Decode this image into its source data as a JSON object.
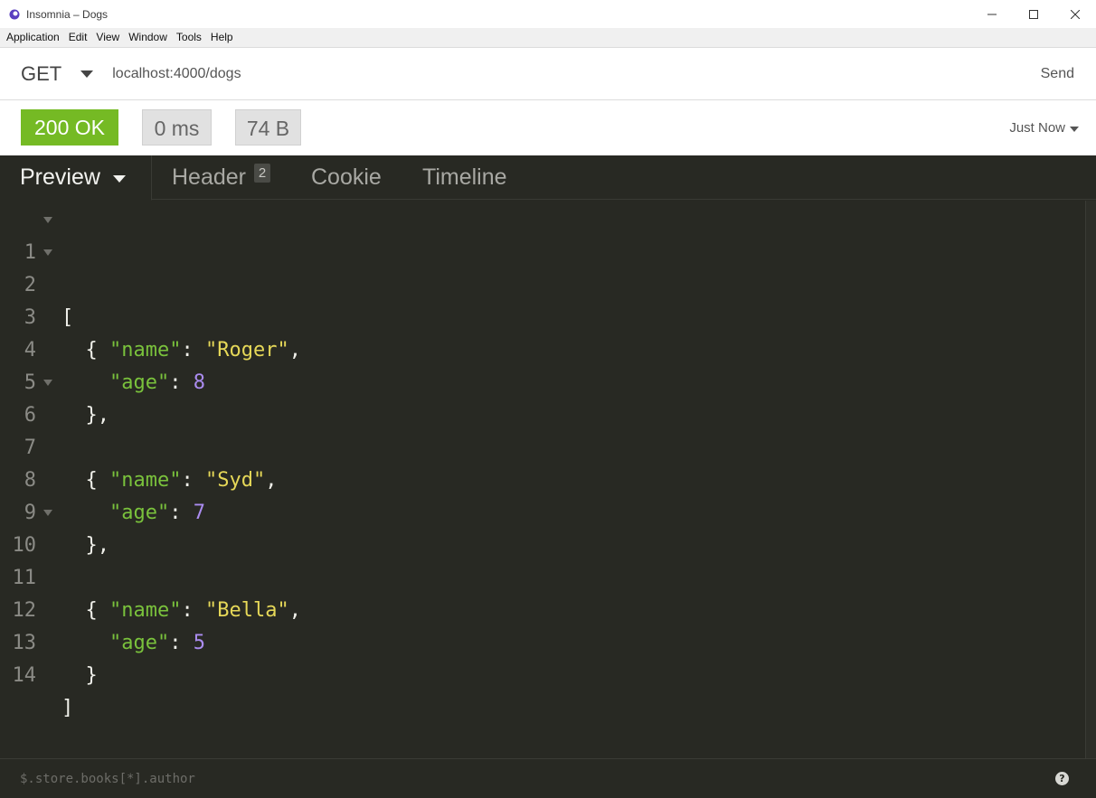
{
  "window": {
    "title": "Insomnia – Dogs"
  },
  "menu": {
    "items": [
      "Application",
      "Edit",
      "View",
      "Window",
      "Tools",
      "Help"
    ]
  },
  "request": {
    "method": "GET",
    "url": "localhost:4000/dogs",
    "send_label": "Send"
  },
  "response": {
    "status": "200 OK",
    "time": "0 ms",
    "size": "74 B",
    "history": "Just Now"
  },
  "tabs": {
    "preview": "Preview",
    "header": "Header",
    "header_count": "2",
    "cookie": "Cookie",
    "timeline": "Timeline"
  },
  "body": {
    "lines": [
      {
        "num": "1",
        "fold": true
      },
      {
        "num": "2",
        "fold": true
      },
      {
        "num": "3",
        "key": "\"name\"",
        "value": "\"Roger\""
      },
      {
        "num": "4",
        "key": "\"age\"",
        "value": "8"
      },
      {
        "num": "5"
      },
      {
        "num": "6",
        "fold": true
      },
      {
        "num": "7",
        "key": "\"name\"",
        "value": "\"Syd\""
      },
      {
        "num": "8",
        "key": "\"age\"",
        "value": "7"
      },
      {
        "num": "9"
      },
      {
        "num": "10",
        "fold": true
      },
      {
        "num": "11",
        "key": "\"name\"",
        "value": "\"Bella\""
      },
      {
        "num": "12",
        "key": "\"age\"",
        "value": "5"
      },
      {
        "num": "13"
      },
      {
        "num": "14"
      }
    ]
  },
  "filter": {
    "placeholder": "$.store.books[*].author"
  },
  "colors": {
    "status_ok": "#75ba24",
    "editor_bg": "#282923",
    "json_key": "#7ac23c",
    "json_string": "#e6d858",
    "json_number": "#ab8cf0"
  }
}
